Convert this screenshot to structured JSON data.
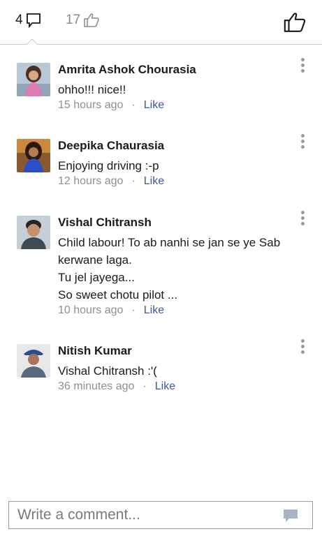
{
  "tabs": {
    "comments_count": "4",
    "likes_count": "17"
  },
  "comments": [
    {
      "author": "Amrita Ashok Chourasia",
      "text": "ohho!!! nice!!",
      "time": "15 hours ago",
      "like": "Like"
    },
    {
      "author": "Deepika Chaurasia",
      "text": "Enjoying driving :-p",
      "time": "12 hours ago",
      "like": "Like"
    },
    {
      "author": "Vishal Chitransh",
      "text_lines": [
        "Child labour! To ab nanhi se jan se ye Sab kerwane laga.",
        "Tu jel jayega...",
        "So sweet chotu pilot ..."
      ],
      "time": "10 hours ago",
      "like": "Like"
    },
    {
      "author": "Nitish Kumar",
      "text": "Vishal Chitransh :'(",
      "time": "36 minutes ago",
      "like": "Like"
    }
  ],
  "meta_separator": "·",
  "composer": {
    "placeholder": "Write a comment..."
  },
  "colors": {
    "link": "#3b5998",
    "muted": "#8f8f8f",
    "divider": "#c8c8c8"
  },
  "icons": [
    "comment-icon",
    "thumbs-up-icon",
    "more-options-icon",
    "send-comment-icon"
  ]
}
